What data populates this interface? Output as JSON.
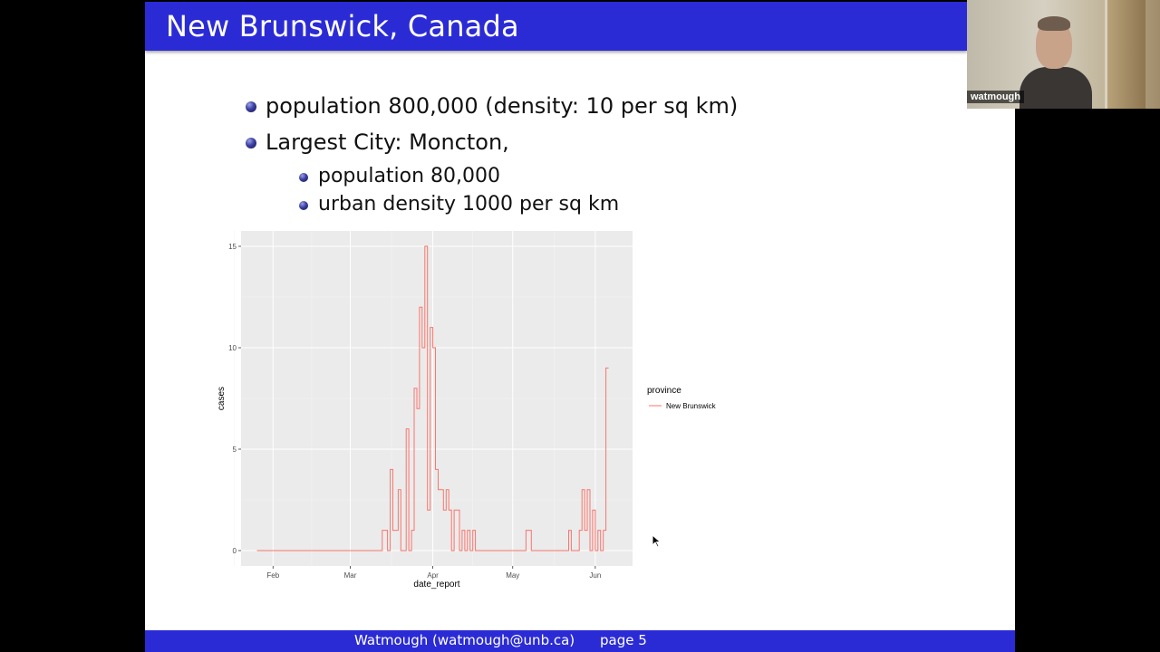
{
  "slide": {
    "title": "New Brunswick, Canada",
    "bullets": {
      "population": "population 800,000 (density: 10 per sq km)",
      "largest_city": "Largest City: Moncton,",
      "city_population": "population 80,000",
      "city_density": "urban density 1000 per sq km"
    }
  },
  "chart_data": {
    "type": "line",
    "step": true,
    "xlabel": "date_report",
    "ylabel": "cases",
    "xlim": [
      "2020-01-20",
      "2020-06-15"
    ],
    "ylim": [
      0,
      15
    ],
    "x_ticks": [
      {
        "date": "2020-02-01",
        "label": "Feb"
      },
      {
        "date": "2020-03-01",
        "label": "Mar"
      },
      {
        "date": "2020-04-01",
        "label": "Apr"
      },
      {
        "date": "2020-05-01",
        "label": "May"
      },
      {
        "date": "2020-06-01",
        "label": "Jun"
      }
    ],
    "y_ticks": [
      0,
      5,
      10,
      15
    ],
    "grid": true,
    "legend": {
      "title": "province",
      "position": "right"
    },
    "series": [
      {
        "name": "New Brunswick",
        "color": "#f8766d",
        "points": [
          [
            "2020-01-26",
            0
          ],
          [
            "2020-03-12",
            0
          ],
          [
            "2020-03-13",
            1
          ],
          [
            "2020-03-15",
            0
          ],
          [
            "2020-03-16",
            4
          ],
          [
            "2020-03-17",
            1
          ],
          [
            "2020-03-18",
            1
          ],
          [
            "2020-03-19",
            3
          ],
          [
            "2020-03-20",
            0
          ],
          [
            "2020-03-22",
            6
          ],
          [
            "2020-03-23",
            0
          ],
          [
            "2020-03-24",
            1
          ],
          [
            "2020-03-25",
            8
          ],
          [
            "2020-03-26",
            7
          ],
          [
            "2020-03-27",
            12
          ],
          [
            "2020-03-28",
            10
          ],
          [
            "2020-03-29",
            15
          ],
          [
            "2020-03-30",
            2
          ],
          [
            "2020-03-31",
            11
          ],
          [
            "2020-04-01",
            10
          ],
          [
            "2020-04-02",
            4
          ],
          [
            "2020-04-03",
            3
          ],
          [
            "2020-04-04",
            3
          ],
          [
            "2020-04-05",
            2
          ],
          [
            "2020-04-06",
            3
          ],
          [
            "2020-04-07",
            2
          ],
          [
            "2020-04-08",
            0
          ],
          [
            "2020-04-09",
            2
          ],
          [
            "2020-04-10",
            2
          ],
          [
            "2020-04-11",
            0
          ],
          [
            "2020-04-12",
            1
          ],
          [
            "2020-04-13",
            0
          ],
          [
            "2020-04-14",
            1
          ],
          [
            "2020-04-15",
            0
          ],
          [
            "2020-04-16",
            1
          ],
          [
            "2020-04-17",
            0
          ],
          [
            "2020-04-21",
            0
          ],
          [
            "2020-04-22",
            0
          ],
          [
            "2020-05-02",
            0
          ],
          [
            "2020-05-06",
            1
          ],
          [
            "2020-05-08",
            0
          ],
          [
            "2020-05-21",
            0
          ],
          [
            "2020-05-22",
            1
          ],
          [
            "2020-05-23",
            0
          ],
          [
            "2020-05-26",
            1
          ],
          [
            "2020-05-27",
            3
          ],
          [
            "2020-05-28",
            1
          ],
          [
            "2020-05-29",
            3
          ],
          [
            "2020-05-30",
            0
          ],
          [
            "2020-05-31",
            2
          ],
          [
            "2020-06-01",
            0
          ],
          [
            "2020-06-02",
            1
          ],
          [
            "2020-06-03",
            0
          ],
          [
            "2020-06-04",
            1
          ],
          [
            "2020-06-05",
            9
          ],
          [
            "2020-06-06",
            9
          ]
        ]
      }
    ]
  },
  "footer": {
    "author": "Watmough (watmough@unb.ca)",
    "page": "page 5"
  },
  "webcam": {
    "participant_name": "watmough"
  }
}
